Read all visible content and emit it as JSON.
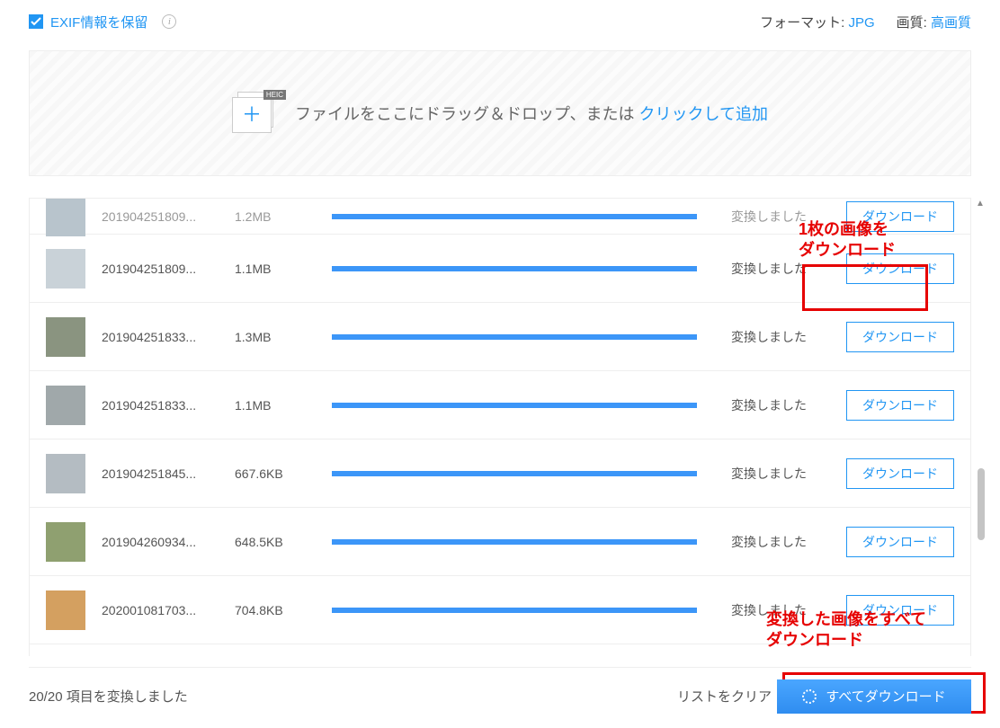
{
  "topbar": {
    "exif_label": "EXIF情報を保留",
    "format_label": "フォーマット:",
    "format_value": "JPG",
    "quality_label": "画質:",
    "quality_value": "高画質"
  },
  "dropzone": {
    "heic_tag": "HEIC",
    "text_pre": "ファイルをここにドラッグ＆ドロップ、または ",
    "link": "クリックして追加"
  },
  "rows": [
    {
      "name": "201904251809...",
      "size": "1.2MB",
      "status": "変換しました",
      "download": "ダウンロード",
      "cutoff": true
    },
    {
      "name": "201904251809...",
      "size": "1.1MB",
      "status": "変換しました",
      "download": "ダウンロード"
    },
    {
      "name": "201904251833...",
      "size": "1.3MB",
      "status": "変換しました",
      "download": "ダウンロード"
    },
    {
      "name": "201904251833...",
      "size": "1.1MB",
      "status": "変換しました",
      "download": "ダウンロード"
    },
    {
      "name": "201904251845...",
      "size": "667.6KB",
      "status": "変換しました",
      "download": "ダウンロード"
    },
    {
      "name": "201904260934...",
      "size": "648.5KB",
      "status": "変換しました",
      "download": "ダウンロード"
    },
    {
      "name": "202001081703...",
      "size": "704.8KB",
      "status": "変換しました",
      "download": "ダウンロード"
    }
  ],
  "annotations": {
    "single": "1枚の画像を\nダウンロード",
    "all": "変換した画像をすべて\nダウンロード"
  },
  "footer": {
    "summary": "20/20 項目を変換しました",
    "clear_label": "リストをクリア",
    "all_download": "すべてダウンロード"
  },
  "thumb_colors": [
    "#b8c4cc",
    "#c9d2d8",
    "#8a9480",
    "#a0a8aa",
    "#b4bcc2",
    "#8fa070",
    "#d4a060"
  ]
}
